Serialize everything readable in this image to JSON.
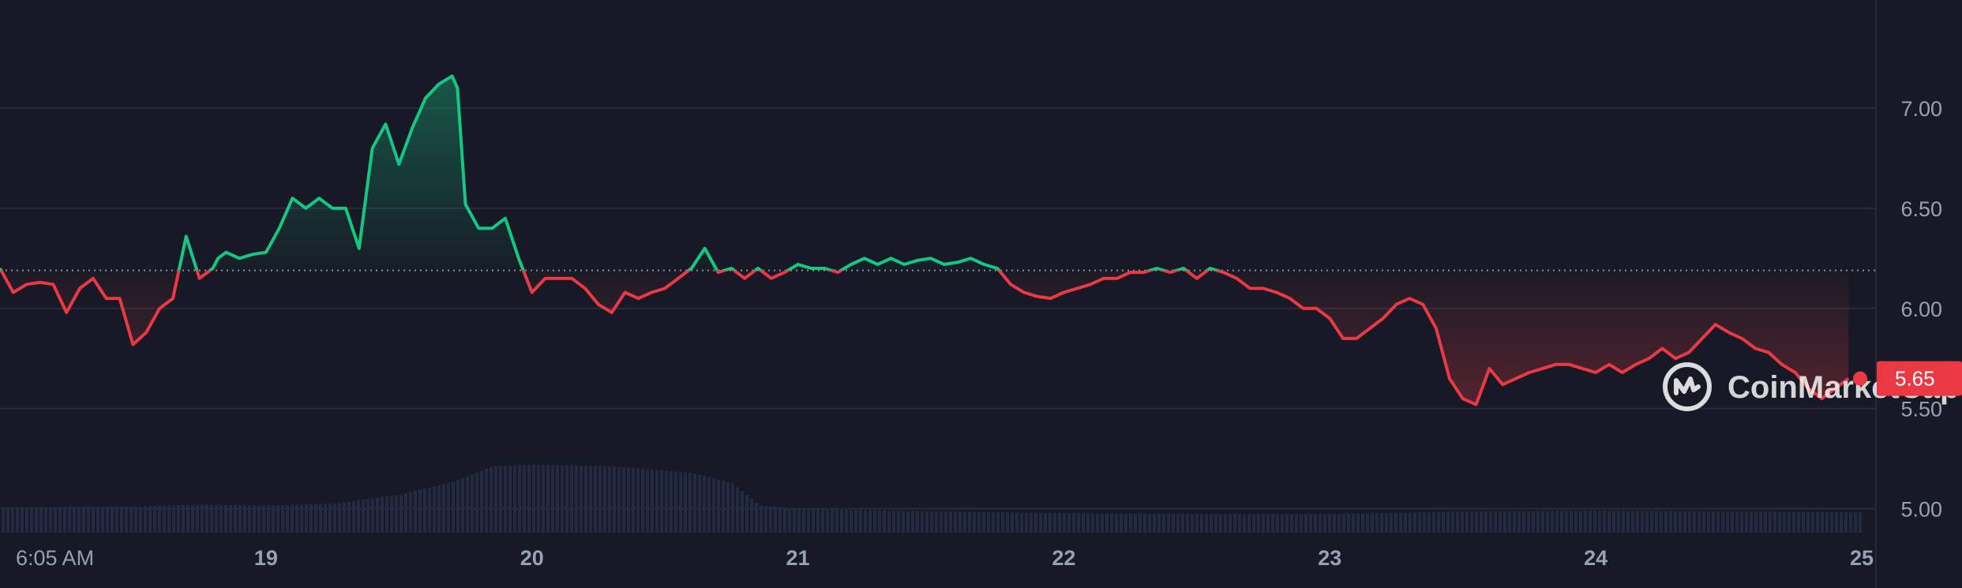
{
  "watermark": {
    "text": "CoinMarketCap"
  },
  "colors": {
    "background": "#171a26",
    "up": "#16c784",
    "down": "#ea3943",
    "grid": "#262a3a",
    "baseline": "#8b8f9e",
    "tick_text": "#9aa0b4",
    "volume": "#232a44"
  },
  "chart_data": {
    "type": "line",
    "baseline": 6.19,
    "last_price": {
      "label": "5.65",
      "value": 5.65
    },
    "xlabels": [
      "6:05 AM",
      "19",
      "20",
      "21",
      "22",
      "23",
      "24",
      "25"
    ],
    "x_ticks": [
      {
        "label": "6:05 AM",
        "day": 18.25,
        "bold": false
      },
      {
        "label": "19",
        "day": 19,
        "bold": true
      },
      {
        "label": "20",
        "day": 20,
        "bold": true
      },
      {
        "label": "21",
        "day": 21,
        "bold": true
      },
      {
        "label": "22",
        "day": 22,
        "bold": true
      },
      {
        "label": "23",
        "day": 23,
        "bold": true
      },
      {
        "label": "24",
        "day": 24,
        "bold": true
      },
      {
        "label": "25",
        "day": 25,
        "bold": true
      }
    ],
    "y_ticks": [
      {
        "label": "5.00",
        "value": 5.0
      },
      {
        "label": "5.50",
        "value": 5.5
      },
      {
        "label": "6.00",
        "value": 6.0
      },
      {
        "label": "6.50",
        "value": 6.5
      },
      {
        "label": "7.00",
        "value": 7.0
      }
    ],
    "xlim": [
      18.0,
      25.0
    ],
    "ylim": [
      4.88,
      7.54
    ],
    "grid": true,
    "series": [
      {
        "points": [
          [
            18.0,
            6.2
          ],
          [
            18.05,
            6.08
          ],
          [
            18.1,
            6.12
          ],
          [
            18.15,
            6.13
          ],
          [
            18.2,
            6.12
          ],
          [
            18.25,
            5.98
          ],
          [
            18.3,
            6.1
          ],
          [
            18.35,
            6.15
          ],
          [
            18.4,
            6.05
          ],
          [
            18.45,
            6.05
          ],
          [
            18.5,
            5.82
          ],
          [
            18.55,
            5.88
          ],
          [
            18.6,
            6.0
          ],
          [
            18.65,
            6.05
          ],
          [
            18.7,
            6.36
          ],
          [
            18.75,
            6.15
          ],
          [
            18.8,
            6.2
          ],
          [
            18.82,
            6.25
          ],
          [
            18.85,
            6.28
          ],
          [
            18.9,
            6.25
          ],
          [
            18.95,
            6.27
          ],
          [
            19.0,
            6.28
          ],
          [
            19.05,
            6.4
          ],
          [
            19.1,
            6.55
          ],
          [
            19.15,
            6.5
          ],
          [
            19.2,
            6.55
          ],
          [
            19.25,
            6.5
          ],
          [
            19.3,
            6.5
          ],
          [
            19.35,
            6.3
          ],
          [
            19.4,
            6.8
          ],
          [
            19.45,
            6.92
          ],
          [
            19.5,
            6.72
          ],
          [
            19.55,
            6.9
          ],
          [
            19.6,
            7.05
          ],
          [
            19.65,
            7.12
          ],
          [
            19.7,
            7.16
          ],
          [
            19.72,
            7.1
          ],
          [
            19.75,
            6.52
          ],
          [
            19.8,
            6.4
          ],
          [
            19.85,
            6.4
          ],
          [
            19.9,
            6.45
          ],
          [
            19.95,
            6.25
          ],
          [
            20.0,
            6.08
          ],
          [
            20.05,
            6.15
          ],
          [
            20.1,
            6.15
          ],
          [
            20.15,
            6.15
          ],
          [
            20.2,
            6.1
          ],
          [
            20.25,
            6.02
          ],
          [
            20.3,
            5.98
          ],
          [
            20.35,
            6.08
          ],
          [
            20.4,
            6.05
          ],
          [
            20.45,
            6.08
          ],
          [
            20.5,
            6.1
          ],
          [
            20.55,
            6.15
          ],
          [
            20.6,
            6.2
          ],
          [
            20.65,
            6.3
          ],
          [
            20.7,
            6.18
          ],
          [
            20.75,
            6.2
          ],
          [
            20.8,
            6.15
          ],
          [
            20.85,
            6.2
          ],
          [
            20.9,
            6.15
          ],
          [
            20.95,
            6.18
          ],
          [
            21.0,
            6.22
          ],
          [
            21.05,
            6.2
          ],
          [
            21.1,
            6.2
          ],
          [
            21.15,
            6.18
          ],
          [
            21.2,
            6.22
          ],
          [
            21.25,
            6.25
          ],
          [
            21.3,
            6.22
          ],
          [
            21.35,
            6.25
          ],
          [
            21.4,
            6.22
          ],
          [
            21.45,
            6.24
          ],
          [
            21.5,
            6.25
          ],
          [
            21.55,
            6.22
          ],
          [
            21.6,
            6.23
          ],
          [
            21.65,
            6.25
          ],
          [
            21.7,
            6.22
          ],
          [
            21.75,
            6.2
          ],
          [
            21.8,
            6.12
          ],
          [
            21.85,
            6.08
          ],
          [
            21.9,
            6.06
          ],
          [
            21.95,
            6.05
          ],
          [
            22.0,
            6.08
          ],
          [
            22.05,
            6.1
          ],
          [
            22.1,
            6.12
          ],
          [
            22.15,
            6.15
          ],
          [
            22.2,
            6.15
          ],
          [
            22.25,
            6.18
          ],
          [
            22.3,
            6.18
          ],
          [
            22.35,
            6.2
          ],
          [
            22.4,
            6.18
          ],
          [
            22.45,
            6.2
          ],
          [
            22.5,
            6.15
          ],
          [
            22.55,
            6.2
          ],
          [
            22.6,
            6.18
          ],
          [
            22.65,
            6.15
          ],
          [
            22.7,
            6.1
          ],
          [
            22.75,
            6.1
          ],
          [
            22.8,
            6.08
          ],
          [
            22.85,
            6.05
          ],
          [
            22.9,
            6.0
          ],
          [
            22.95,
            6.0
          ],
          [
            23.0,
            5.95
          ],
          [
            23.05,
            5.85
          ],
          [
            23.1,
            5.85
          ],
          [
            23.15,
            5.9
          ],
          [
            23.2,
            5.95
          ],
          [
            23.25,
            6.02
          ],
          [
            23.3,
            6.05
          ],
          [
            23.35,
            6.02
          ],
          [
            23.4,
            5.9
          ],
          [
            23.45,
            5.65
          ],
          [
            23.5,
            5.55
          ],
          [
            23.55,
            5.52
          ],
          [
            23.6,
            5.7
          ],
          [
            23.65,
            5.62
          ],
          [
            23.7,
            5.65
          ],
          [
            23.75,
            5.68
          ],
          [
            23.8,
            5.7
          ],
          [
            23.85,
            5.72
          ],
          [
            23.9,
            5.72
          ],
          [
            23.95,
            5.7
          ],
          [
            24.0,
            5.68
          ],
          [
            24.05,
            5.72
          ],
          [
            24.1,
            5.68
          ],
          [
            24.15,
            5.72
          ],
          [
            24.2,
            5.75
          ],
          [
            24.25,
            5.8
          ],
          [
            24.3,
            5.75
          ],
          [
            24.35,
            5.78
          ],
          [
            24.4,
            5.85
          ],
          [
            24.45,
            5.92
          ],
          [
            24.5,
            5.88
          ],
          [
            24.55,
            5.85
          ],
          [
            24.6,
            5.8
          ],
          [
            24.65,
            5.78
          ],
          [
            24.7,
            5.72
          ],
          [
            24.75,
            5.68
          ],
          [
            24.8,
            5.6
          ],
          [
            24.85,
            5.55
          ],
          [
            24.9,
            5.6
          ],
          [
            24.95,
            5.65
          ]
        ]
      }
    ],
    "volume": [
      [
        18.0,
        0.3
      ],
      [
        18.5,
        0.31
      ],
      [
        18.75,
        0.33
      ],
      [
        19.0,
        0.32
      ],
      [
        19.25,
        0.34
      ],
      [
        19.5,
        0.45
      ],
      [
        19.7,
        0.6
      ],
      [
        19.85,
        0.78
      ],
      [
        20.0,
        0.8
      ],
      [
        20.3,
        0.78
      ],
      [
        20.6,
        0.7
      ],
      [
        20.75,
        0.58
      ],
      [
        20.85,
        0.32
      ],
      [
        21.0,
        0.28
      ],
      [
        21.5,
        0.25
      ],
      [
        22.0,
        0.23
      ],
      [
        22.5,
        0.22
      ],
      [
        23.0,
        0.22
      ],
      [
        23.5,
        0.25
      ],
      [
        24.0,
        0.26
      ],
      [
        24.5,
        0.25
      ],
      [
        25.0,
        0.24
      ]
    ]
  }
}
